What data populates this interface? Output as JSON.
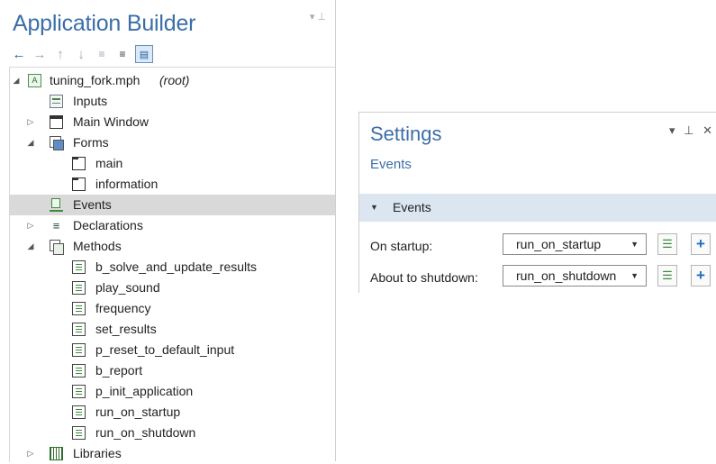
{
  "builder": {
    "title": "Application Builder",
    "window_controls": "▾ ⊥",
    "toolbar": [
      "back",
      "forward",
      "move-up",
      "move-down",
      "collapse",
      "expand",
      "show"
    ],
    "tree": [
      {
        "label": "tuning_fork.mph",
        "suffix": "(root)",
        "icon": "root-icon",
        "level": 0,
        "expander": "expanded"
      },
      {
        "label": "Inputs",
        "icon": "inputs-icon",
        "level": 1,
        "expander": "none"
      },
      {
        "label": "Main Window",
        "icon": "window-icon",
        "level": 1,
        "expander": "collapsed"
      },
      {
        "label": "Forms",
        "icon": "forms-icon",
        "level": 1,
        "expander": "expanded"
      },
      {
        "label": "main",
        "icon": "form-icon",
        "level": 2,
        "expander": "none"
      },
      {
        "label": "information",
        "icon": "form-icon",
        "level": 2,
        "expander": "none"
      },
      {
        "label": "Events",
        "icon": "events-icon",
        "level": 1,
        "expander": "none",
        "selected": true
      },
      {
        "label": "Declarations",
        "icon": "declarations-icon",
        "level": 1,
        "expander": "collapsed"
      },
      {
        "label": "Methods",
        "icon": "methods-icon",
        "level": 1,
        "expander": "expanded"
      },
      {
        "label": "b_solve_and_update_results",
        "icon": "method-icon",
        "level": 2,
        "expander": "none"
      },
      {
        "label": "play_sound",
        "icon": "method-icon",
        "level": 2,
        "expander": "none"
      },
      {
        "label": "frequency",
        "icon": "method-icon",
        "level": 2,
        "expander": "none"
      },
      {
        "label": "set_results",
        "icon": "method-icon",
        "level": 2,
        "expander": "none"
      },
      {
        "label": "p_reset_to_default_input",
        "icon": "method-icon",
        "level": 2,
        "expander": "none"
      },
      {
        "label": "b_report",
        "icon": "method-icon",
        "level": 2,
        "expander": "none"
      },
      {
        "label": "p_init_application",
        "icon": "method-icon",
        "level": 2,
        "expander": "none"
      },
      {
        "label": "run_on_startup",
        "icon": "method-icon",
        "level": 2,
        "expander": "none"
      },
      {
        "label": "run_on_shutdown",
        "icon": "method-icon",
        "level": 2,
        "expander": "none"
      },
      {
        "label": "Libraries",
        "icon": "libraries-icon",
        "level": 1,
        "expander": "collapsed"
      }
    ]
  },
  "settings": {
    "title": "Settings",
    "subtitle": "Events",
    "window_controls": "▾ ⊥ ✕",
    "section_label": "Events",
    "fields": [
      {
        "label": "On startup:",
        "value": "run_on_startup"
      },
      {
        "label": "About to shutdown:",
        "value": "run_on_shutdown"
      }
    ]
  }
}
